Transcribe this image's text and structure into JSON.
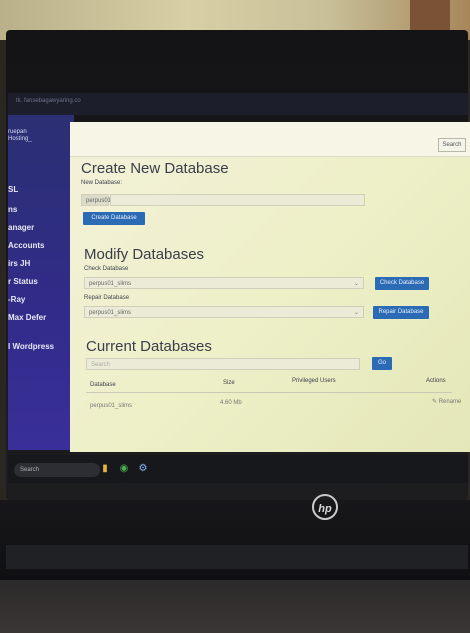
{
  "browser": {
    "url": "tk. fansebagawyaring.co"
  },
  "sidebar": {
    "logo_line1": "ruepan",
    "logo_line2": "Hosting_",
    "items": [
      "SL",
      "ns",
      "anager",
      "Accounts",
      "irs JH",
      "r Status",
      "-Ray",
      "Max Defer",
      "l Wordpress"
    ]
  },
  "topbar": {
    "search_label": "Search"
  },
  "create": {
    "title": "Create New Database",
    "new_db_label": "New Database:",
    "prefix": "perpus01",
    "button": "Create Database"
  },
  "modify": {
    "title": "Modify Databases",
    "check_label": "Check Database",
    "check_value": "perpus01_slims",
    "check_button": "Check Database",
    "repair_label": "Repair Database",
    "repair_value": "perpus01_slims",
    "repair_button": "Repair Database"
  },
  "current": {
    "title": "Current Databases",
    "search_placeholder": "Search",
    "go_button": "Go",
    "columns": [
      "Database",
      "Size",
      "Privileged Users",
      "Actions"
    ],
    "rows": [
      {
        "database": "perpus01_slims",
        "size": "4.60 Mb",
        "users": "",
        "action": "Rename"
      }
    ]
  },
  "taskbar": {
    "search_label": "Search"
  },
  "brand": {
    "logo": "hp"
  }
}
